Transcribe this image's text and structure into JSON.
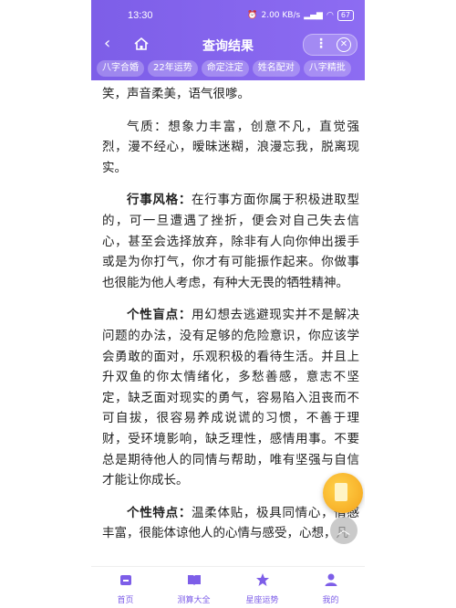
{
  "status": {
    "time": "13:30",
    "network": "2.00 KB/s",
    "battery": "67"
  },
  "nav": {
    "title": "查询结果",
    "more": "⋮",
    "close": "✕"
  },
  "tabs": [
    "八字合婚",
    "22年运势",
    "命定注定",
    "姓名配对",
    "八字精批"
  ],
  "content": {
    "p0": "笑，声音柔美，语气很嗲。",
    "p1": "气质：想象力丰富，创意不凡，直觉强烈，漫不经心，暧昧迷糊，浪漫忘我，脱离现实。",
    "p2_label": "行事风格：",
    "p2_text": "在行事方面你属于积极进取型的，可一旦遭遇了挫折，便会对自己失去信心，甚至会选择放弃，除非有人向你伸出援手或是为你打气，你才有可能振作起来。你做事也很能为他人考虑，有种大无畏的牺牲精神。",
    "p3_label": "个性盲点：",
    "p3_text": "用幻想去逃避现实并不是解决问题的办法，没有足够的危险意识，你应该学会勇敢的面对，乐观积极的看待生活。并且上升双鱼的你太情绪化，多愁善感，意志不坚定，缺乏面对现实的勇气，容易陷入沮丧而不可自拔，很容易养成说谎的习惯，不善于理财，受环境影响，缺乏理性，感情用事。不要总是期待他人的同情与帮助，唯有坚强与自信才能让你成长。",
    "p4_label": "个性特点：",
    "p4_text": "温柔体贴，极具同情心，情感丰富，很能体谅他人的心情与感受，心想，凡"
  },
  "bottom_nav": [
    "首页",
    "测算大全",
    "星座运势",
    "我的"
  ],
  "colors": {
    "accent": "#7d5ee8"
  }
}
